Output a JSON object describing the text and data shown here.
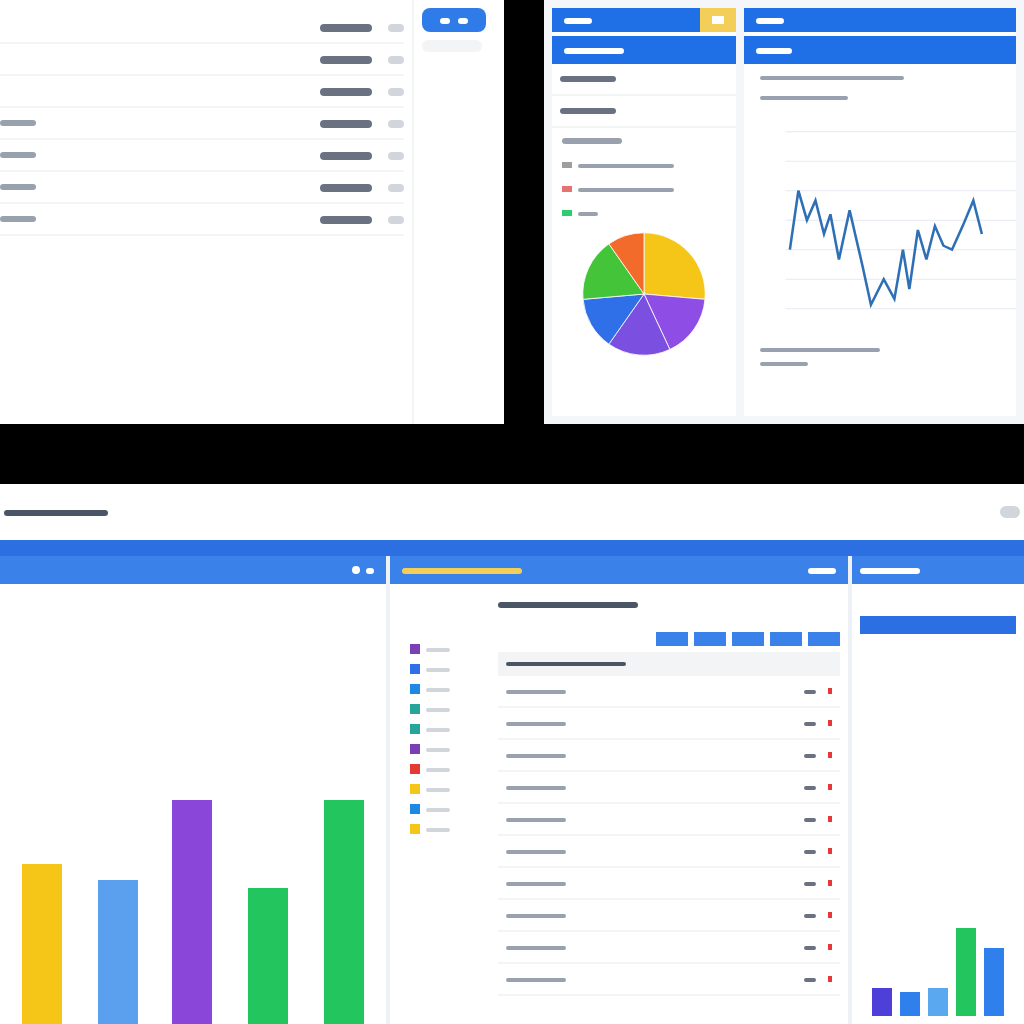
{
  "top_left_table": {
    "rows": [
      {
        "kind": "row"
      },
      {
        "kind": "row"
      },
      {
        "kind": "row"
      },
      {
        "kind": "row"
      },
      {
        "kind": "row"
      },
      {
        "kind": "row"
      },
      {
        "kind": "row"
      }
    ]
  },
  "legend": {
    "items": [
      {
        "color": "#9e9e9e"
      },
      {
        "color": "#e57373"
      },
      {
        "color": "#2ecc71"
      }
    ]
  },
  "pie": {
    "slices": [
      {
        "color": "#f5c518"
      },
      {
        "color": "#8e4ee6"
      },
      {
        "color": "#7b4fe0"
      },
      {
        "color": "#2f6fe8"
      },
      {
        "color": "#43c439"
      },
      {
        "color": "#f26b2a"
      }
    ]
  },
  "bar_chart": {
    "bars": [
      {
        "color": "#f5c518"
      },
      {
        "color": "#5aa0ef"
      },
      {
        "color": "#8a46d8"
      },
      {
        "color": "#22c55e"
      },
      {
        "color": "#22c55e"
      }
    ]
  },
  "file_list": {
    "items": [
      {
        "color": "#7b3fb5"
      },
      {
        "color": "#2f6fe8"
      },
      {
        "color": "#1e88e5"
      },
      {
        "color": "#26a69a"
      },
      {
        "color": "#26a69a"
      },
      {
        "color": "#7b3fb5"
      },
      {
        "color": "#e53935"
      },
      {
        "color": "#f5c518"
      },
      {
        "color": "#1e88e5"
      },
      {
        "color": "#f5c518"
      }
    ]
  },
  "data_table": {
    "rows": [
      {
        "kind": "row"
      },
      {
        "kind": "row"
      },
      {
        "kind": "row"
      },
      {
        "kind": "row"
      },
      {
        "kind": "row"
      },
      {
        "kind": "row"
      },
      {
        "kind": "row"
      },
      {
        "kind": "row"
      },
      {
        "kind": "row"
      },
      {
        "kind": "row"
      }
    ]
  },
  "side_bars": {
    "bars": [
      {
        "color": "#4f3fd9"
      },
      {
        "color": "#2f80ed"
      },
      {
        "color": "#5aa9f0"
      },
      {
        "color": "#22c55e"
      },
      {
        "color": "#2f80ed"
      }
    ]
  }
}
